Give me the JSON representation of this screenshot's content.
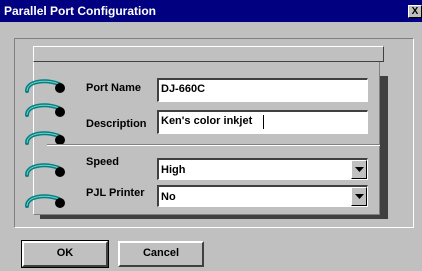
{
  "window": {
    "title": "Parallel Port Configuration",
    "close_label": "X"
  },
  "form": {
    "port_name": {
      "label": "Port Name",
      "value": "DJ-660C"
    },
    "description": {
      "label": "Description",
      "value": "Ken's color inkjet"
    },
    "speed": {
      "label": "Speed",
      "selected": "High"
    },
    "pjl_printer": {
      "label": "PJL Printer",
      "selected": "No"
    }
  },
  "buttons": {
    "ok_label": "OK",
    "cancel_label": "Cancel"
  },
  "colors": {
    "title_bar": "#000080",
    "face": "#c0c0c0",
    "ring": "#008080"
  },
  "icons": [
    "close-icon",
    "binder-ring-icon",
    "dropdown-arrow-icon"
  ]
}
